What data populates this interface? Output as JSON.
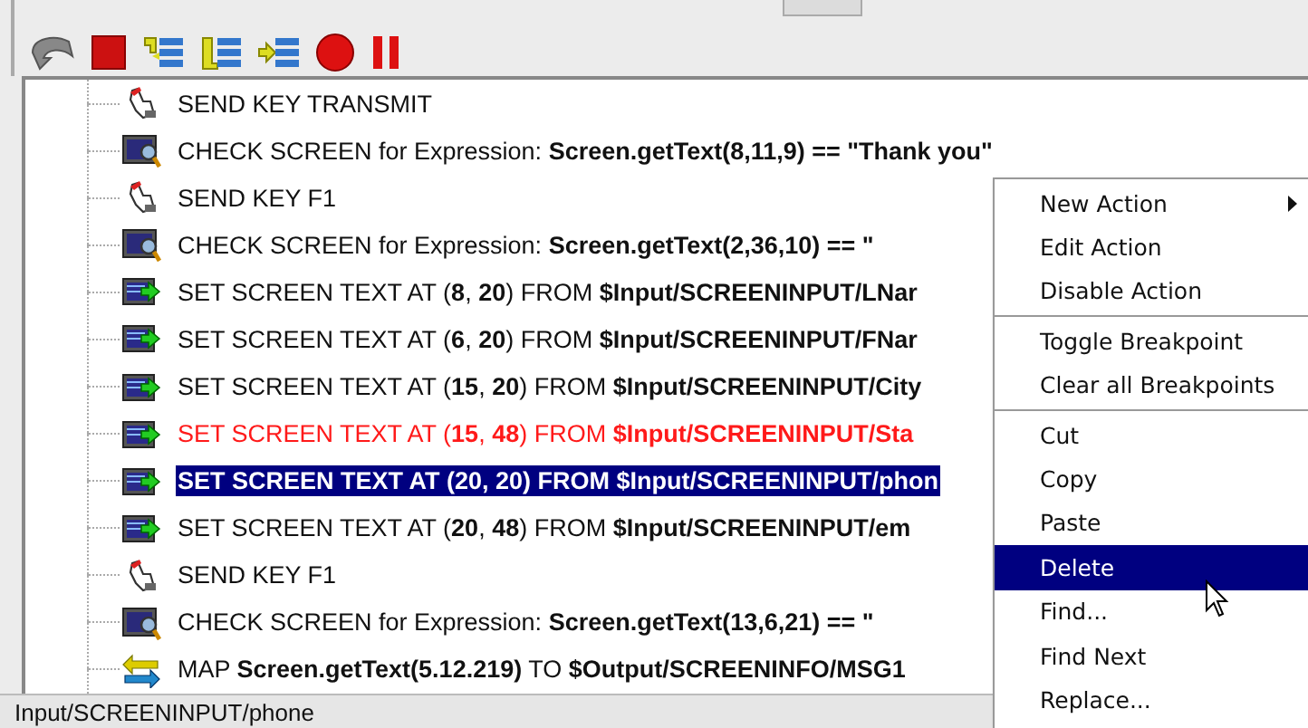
{
  "tree": {
    "rows": [
      {
        "kind": "key",
        "text": "SEND KEY TRANSMIT",
        "selected": false,
        "flagged": false
      },
      {
        "kind": "check",
        "text": "CHECK SCREEN for Expression: **Screen.getText(8,11,9) == \"Thank you\"**",
        "selected": false,
        "flagged": false
      },
      {
        "kind": "key",
        "text": "SEND KEY F1",
        "selected": false,
        "flagged": false
      },
      {
        "kind": "check",
        "text": "CHECK SCREEN for Expression: **Screen.getText(2,36,10) == \"**",
        "selected": false,
        "flagged": false
      },
      {
        "kind": "set",
        "text": "SET SCREEN TEXT AT (**8**, **20**) FROM **$Input/SCREENINPUT/LNar**",
        "selected": false,
        "flagged": false
      },
      {
        "kind": "set",
        "text": "SET SCREEN TEXT AT (**6**, **20**) FROM **$Input/SCREENINPUT/FNar**",
        "selected": false,
        "flagged": false
      },
      {
        "kind": "set",
        "text": "SET SCREEN TEXT AT (**15**, **20**) FROM **$Input/SCREENINPUT/City**",
        "selected": false,
        "flagged": false
      },
      {
        "kind": "set",
        "text": "SET SCREEN TEXT AT (**15**, **48**) FROM **$Input/SCREENINPUT/Sta**",
        "selected": false,
        "flagged": true
      },
      {
        "kind": "set",
        "text": "SET SCREEN TEXT AT (20, 20) FROM **$Input/SCREENINPUT/phon**",
        "selected": true,
        "flagged": false
      },
      {
        "kind": "set",
        "text": "SET SCREEN TEXT AT (**20**, **48**) FROM **$Input/SCREENINPUT/em**",
        "selected": false,
        "flagged": false
      },
      {
        "kind": "key",
        "text": "SEND KEY F1",
        "selected": false,
        "flagged": false
      },
      {
        "kind": "check",
        "text": "CHECK SCREEN for Expression: **Screen.getText(13,6,21) == \"**",
        "selected": false,
        "flagged": false
      },
      {
        "kind": "map",
        "text": "MAP **Screen.getText(5.12.219)** TO **$Output/SCREENINFO/MSG1**",
        "selected": false,
        "flagged": false
      }
    ]
  },
  "context_menu": {
    "groups": [
      [
        {
          "label": "New Action",
          "selected": false,
          "submenu": true
        },
        {
          "label": "Edit Action",
          "selected": false,
          "submenu": false
        },
        {
          "label": "Disable Action",
          "selected": false,
          "submenu": false
        }
      ],
      [
        {
          "label": "Toggle Breakpoint",
          "selected": false,
          "submenu": false
        },
        {
          "label": "Clear all Breakpoints",
          "selected": false,
          "submenu": false
        }
      ],
      [
        {
          "label": "Cut",
          "selected": false,
          "submenu": false
        },
        {
          "label": "Copy",
          "selected": false,
          "submenu": false
        },
        {
          "label": "Paste",
          "selected": false,
          "submenu": false
        },
        {
          "label": "Delete",
          "selected": true,
          "submenu": false
        },
        {
          "label": "Find...",
          "selected": false,
          "submenu": false
        },
        {
          "label": "Find Next",
          "selected": false,
          "submenu": false
        },
        {
          "label": "Replace...",
          "selected": false,
          "submenu": false
        }
      ]
    ]
  },
  "status_bar": {
    "text": "Input/SCREENINPUT/phone"
  }
}
